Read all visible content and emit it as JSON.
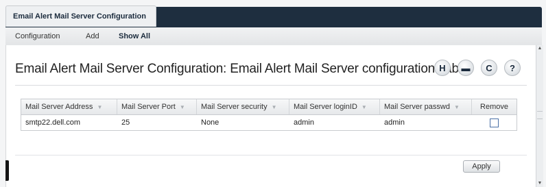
{
  "tab": {
    "title": "Email Alert Mail Server Configuration"
  },
  "subnav": {
    "items": [
      "Configuration",
      "Add",
      "Show All"
    ],
    "active": "Show All"
  },
  "page": {
    "title": "Email Alert Mail Server Configuration: Email Alert Mail Server configuration Table"
  },
  "toolbar": {
    "save_icon": "save-icon",
    "print_icon": "print-icon",
    "refresh_icon": "refresh-icon",
    "help_icon": "help-icon",
    "save_glyph": "H",
    "print_glyph": "▬",
    "refresh_glyph": "C",
    "help_glyph": "?"
  },
  "table": {
    "columns": [
      "Mail Server Address",
      "Mail Server Port",
      "Mail Server security",
      "Mail Server loginID",
      "Mail Server passwd",
      "Remove"
    ],
    "rows": [
      {
        "address": "smtp22.dell.com",
        "port": "25",
        "security": "None",
        "login_id": "admin",
        "passwd": "admin",
        "remove": false
      }
    ]
  },
  "actions": {
    "apply_label": "Apply"
  },
  "colors": {
    "tab_strip": "#1e2e3f",
    "accent_text": "#1b2b3d",
    "checkbox_border": "#4a6fa5"
  }
}
